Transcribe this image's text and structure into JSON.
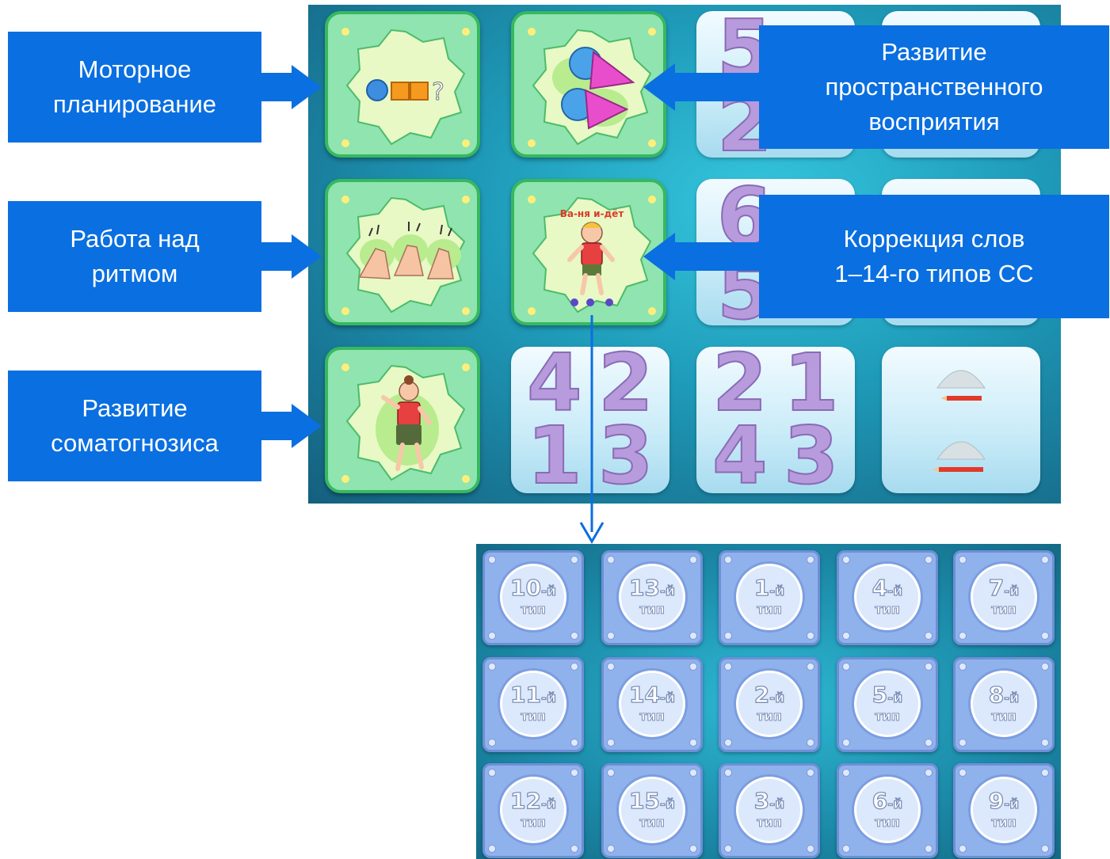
{
  "labels": {
    "motor": [
      "Моторное",
      "планирование"
    ],
    "spatial": [
      "Развитие",
      "пространственного",
      "восприятия"
    ],
    "rhythm": [
      "Работа над",
      "ритмом"
    ],
    "correction": [
      "Коррекция слов",
      "1–14-го типов СС"
    ],
    "somato": [
      "Развитие",
      "соматогнозиса"
    ]
  },
  "vanya_caption": "Ва-ня и-дёт",
  "number_cards": [
    {
      "digits": [
        "4",
        "2",
        "1",
        "3"
      ]
    },
    {
      "digits": [
        "2",
        "1",
        "4",
        "3"
      ]
    }
  ],
  "partial_digits": {
    "row1": [
      "5",
      "2"
    ],
    "row2": [
      "6",
      "5"
    ]
  },
  "question_mark": "?",
  "type_word": "тип",
  "type_suffix": "-й",
  "type_cards": [
    [
      "10",
      "13",
      "1",
      "4",
      "7"
    ],
    [
      "11",
      "14",
      "2",
      "5",
      "8"
    ],
    [
      "12",
      "15",
      "3",
      "6",
      "9"
    ]
  ],
  "colors": {
    "label_bg": "#0a6fe0",
    "green_card": "#8fe4b0",
    "digit": "#b79bdc",
    "type_card": "#8fb2ec"
  }
}
